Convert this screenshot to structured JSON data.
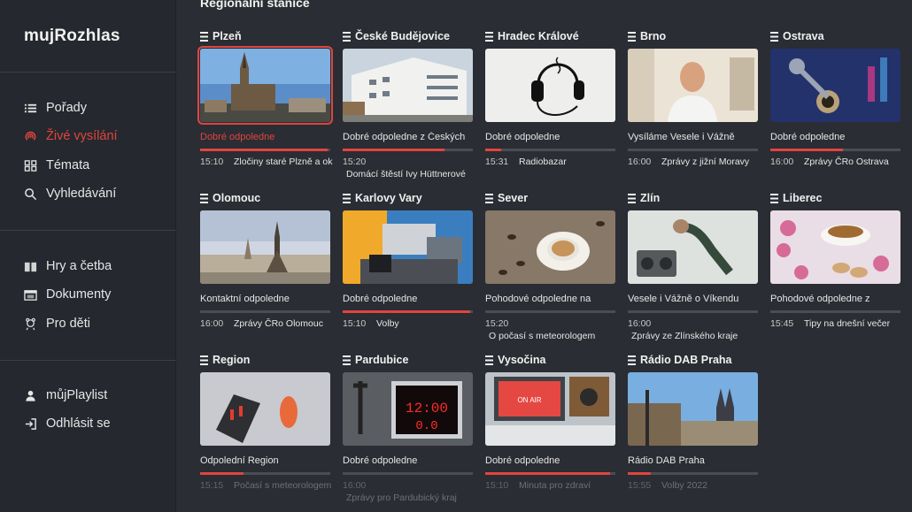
{
  "sidebar": {
    "logo": "mujRozhlas",
    "groups": [
      [
        {
          "label": "Pořady",
          "icon": "list-icon"
        },
        {
          "label": "Živé vysílání",
          "icon": "live-broadcast-icon",
          "active": true
        },
        {
          "label": "Témata",
          "icon": "grid-icon"
        },
        {
          "label": "Vyhledávání",
          "icon": "search-icon"
        }
      ],
      [
        {
          "label": "Hry a četba",
          "icon": "book-icon"
        },
        {
          "label": "Dokumenty",
          "icon": "film-icon"
        },
        {
          "label": "Pro děti",
          "icon": "kids-icon"
        }
      ],
      [
        {
          "label": "můjPlaylist",
          "icon": "user-icon"
        },
        {
          "label": "Odhlásit se",
          "icon": "logout-icon"
        }
      ]
    ]
  },
  "main": {
    "section_title": "Regionální stanice",
    "stations": [
      {
        "name": "Plzeň",
        "show": "Dobré odpoledne",
        "progress": 0.98,
        "next_time": "15:10",
        "next_title": "Zločiny staré Plzně a okolí",
        "selected": true
      },
      {
        "name": "České Budějovice",
        "show": "Dobré odpoledne z Českých",
        "progress": 0.78,
        "next_time": "15:20",
        "next_title": "Domácí štěstí Ivy Hüttnerové"
      },
      {
        "name": "Hradec Králové",
        "show": "Dobré odpoledne",
        "progress": 0.12,
        "next_time": "15:31",
        "next_title": "Radiobazar"
      },
      {
        "name": "Brno",
        "show": "Vysíláme Vesele i Vážně",
        "progress": 0.0,
        "next_time": "16:00",
        "next_title": "Zprávy z jižní Moravy"
      },
      {
        "name": "Ostrava",
        "show": "Dobré odpoledne",
        "progress": 0.56,
        "next_time": "16:00",
        "next_title": "Zprávy ČRo Ostrava"
      },
      {
        "name": "Olomouc",
        "show": "Kontaktní odpoledne",
        "progress": 0.0,
        "next_time": "16:00",
        "next_title": "Zprávy ČRo Olomouc"
      },
      {
        "name": "Karlovy Vary",
        "show": "Dobré odpoledne",
        "progress": 0.98,
        "next_time": "15:10",
        "next_title": "Volby"
      },
      {
        "name": "Sever",
        "show": "Pohodové odpoledne na",
        "progress": 0.0,
        "next_time": "15:20",
        "next_title": "O počasí s meteorologem"
      },
      {
        "name": "Zlín",
        "show": "Vesele i Vážně o Víkendu",
        "progress": 0.0,
        "next_time": "16:00",
        "next_title": "Zprávy ze Zlínského kraje"
      },
      {
        "name": "Liberec",
        "show": "Pohodové odpoledne z",
        "progress": 0.0,
        "next_time": "15:45",
        "next_title": "Tipy na dnešní večer"
      },
      {
        "name": "Region",
        "show": "Odpolední Region",
        "progress": 0.33,
        "next_time": "15:15",
        "next_title": "Počasí s meteorologem"
      },
      {
        "name": "Pardubice",
        "show": "Dobré odpoledne",
        "progress": 0.0,
        "next_time": "16:00",
        "next_title": "Zprávy pro Pardubický kraj"
      },
      {
        "name": "Vysočina",
        "show": "Dobré odpoledne",
        "progress": 0.96,
        "next_time": "15:10",
        "next_title": "Minuta pro zdraví"
      },
      {
        "name": "Rádio DAB Praha",
        "show": "Rádio DAB Praha",
        "progress": 0.18,
        "next_time": "15:55",
        "next_title": "Volby 2022"
      }
    ]
  },
  "colors": {
    "accent": "#e0453f",
    "background": "#2a2d33",
    "sidebar": "#25282e"
  }
}
